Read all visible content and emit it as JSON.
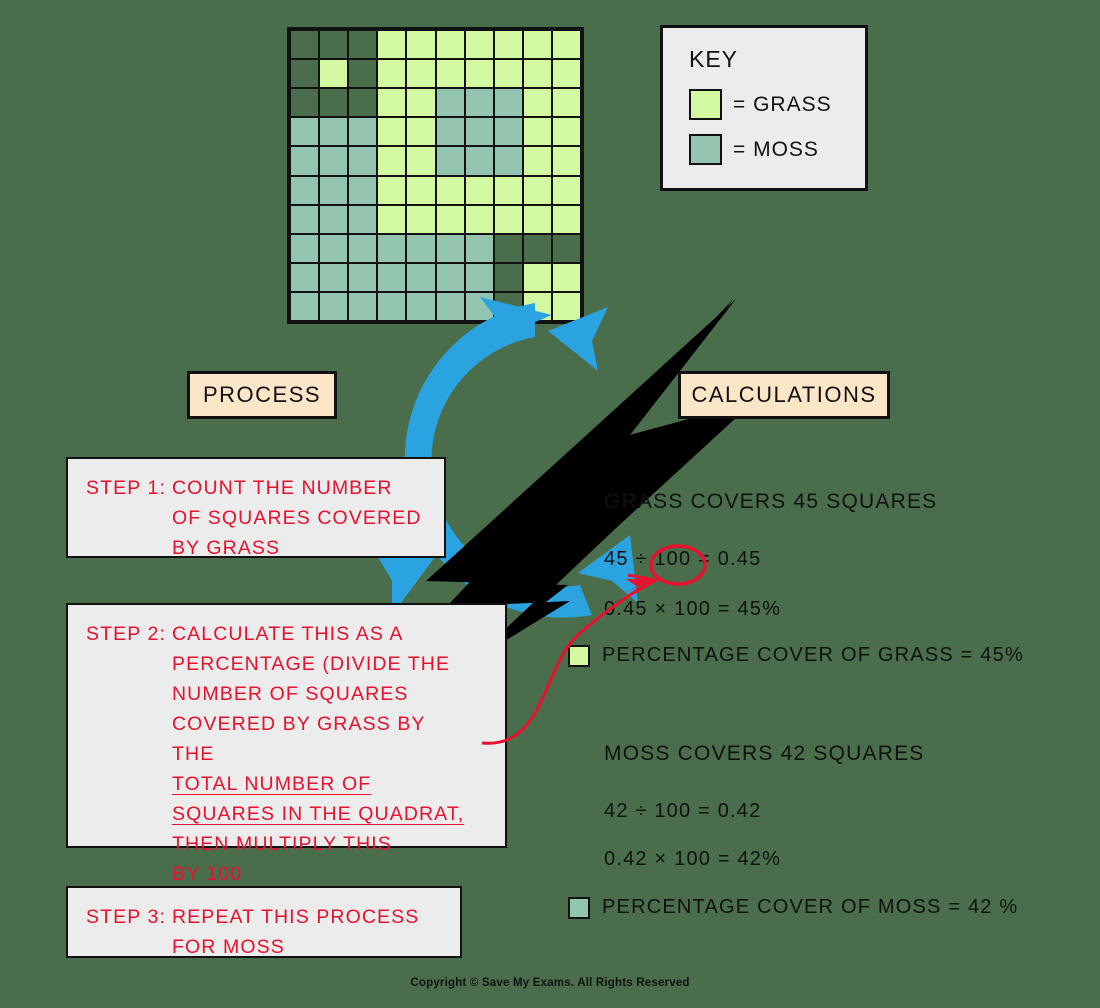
{
  "quadrat": {
    "rows": 10,
    "cols": 10,
    "legend_codes": {
      "G": "grass",
      "M": "moss",
      "E": "empty"
    },
    "cells": [
      [
        "E",
        "E",
        "E",
        "G",
        "G",
        "G",
        "G",
        "G",
        "G",
        "G"
      ],
      [
        "E",
        "G",
        "E",
        "G",
        "G",
        "G",
        "G",
        "G",
        "G",
        "G"
      ],
      [
        "E",
        "E",
        "E",
        "G",
        "G",
        "M",
        "M",
        "M",
        "G",
        "G"
      ],
      [
        "M",
        "M",
        "M",
        "G",
        "G",
        "M",
        "M",
        "M",
        "G",
        "G"
      ],
      [
        "M",
        "M",
        "M",
        "G",
        "G",
        "M",
        "M",
        "M",
        "G",
        "G"
      ],
      [
        "M",
        "M",
        "M",
        "G",
        "G",
        "G",
        "G",
        "G",
        "G",
        "G"
      ],
      [
        "M",
        "M",
        "M",
        "G",
        "G",
        "G",
        "G",
        "G",
        "G",
        "G"
      ],
      [
        "M",
        "M",
        "M",
        "M",
        "M",
        "M",
        "M",
        "E",
        "E",
        "E"
      ],
      [
        "M",
        "M",
        "M",
        "M",
        "M",
        "M",
        "M",
        "E",
        "G",
        "G"
      ],
      [
        "M",
        "M",
        "M",
        "M",
        "M",
        "M",
        "M",
        "E",
        "G",
        "G"
      ]
    ]
  },
  "key": {
    "title": "KEY",
    "items": [
      {
        "label": "= GRASS",
        "color": "#d2f9a2"
      },
      {
        "label": "= MOSS",
        "color": "#92c4b0"
      }
    ]
  },
  "headers": {
    "process": "PROCESS",
    "calculations": "CALCULATIONS"
  },
  "steps": [
    {
      "label": "STEP 1:",
      "lines": [
        "COUNT  THE  NUMBER",
        "OF  SQUARES  COVERED",
        "BY  GRASS"
      ]
    },
    {
      "label": "STEP 2:",
      "lines": [
        "CALCULATE   THIS   AS   A",
        "PERCENTAGE  (DIVIDE  THE",
        "NUMBER   OF   SQUARES",
        "COVERED  BY  GRASS  BY",
        "THE",
        "TOTAL   NUMBER   OF",
        "SQUARES  IN  THE  QUADRAT,",
        "THEN  MULTIPLY  THIS",
        "BY  100"
      ],
      "underlined": [
        "TOTAL   NUMBER   OF",
        "SQUARES  IN  THE  QUADRAT,"
      ]
    },
    {
      "label": "STEP 3:",
      "lines": [
        "REPEAT  THIS  PROCESS",
        "FOR  MOSS"
      ]
    }
  ],
  "calculations": {
    "grass": {
      "heading": "GRASS  COVERS  45  SQUARES",
      "equation1": "45 ÷ 100 = 0.45",
      "equation2": "0.45 × 100 = 45%",
      "result": "PERCENTAGE   COVER   OF  GRASS = 45%",
      "swatch_color": "#d2f9a2",
      "circled_value": "100"
    },
    "moss": {
      "heading": "MOSS  COVERS  42  SQUARES",
      "equation1": "42 ÷ 100 = 0.42",
      "equation2": "0.42 × 100 = 42%",
      "result": "PERCENTAGE   COVER   OF  MOSS = 42 %",
      "swatch_color": "#92c4b0"
    }
  },
  "colors": {
    "background": "#4a6e4c",
    "grass": "#d2f9a2",
    "moss": "#92c4b0",
    "cycle_arrow": "#2aa3e0",
    "bolt": "#000000",
    "annotation_red": "#e8112d",
    "box_fill": "#ececec",
    "pill_fill": "#fce6c8"
  },
  "footer": "Copyright © Save My Exams. All Rights Reserved"
}
